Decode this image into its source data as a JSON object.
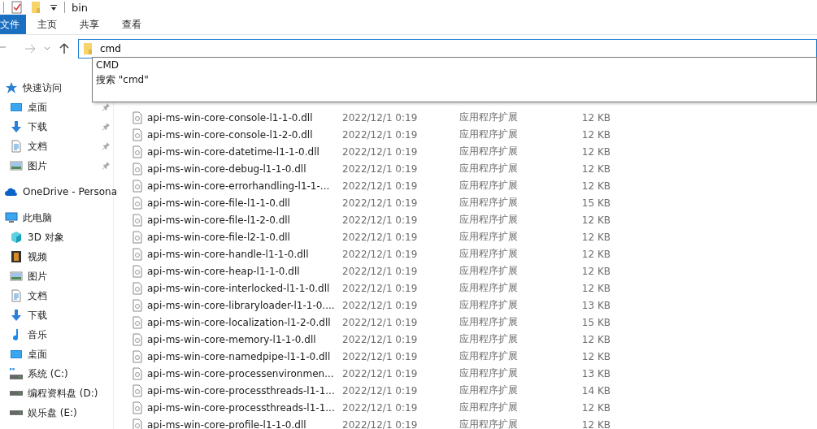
{
  "title_bar": {
    "title": "bin"
  },
  "ribbon": {
    "tabs": [
      {
        "label": "文件",
        "kind": "menu",
        "selected": false
      },
      {
        "label": "主页",
        "kind": "tab",
        "selected": false
      },
      {
        "label": "共享",
        "kind": "tab",
        "selected": false
      },
      {
        "label": "查看",
        "kind": "tab",
        "selected": false
      }
    ]
  },
  "address_bar": {
    "value": "cmd",
    "suggestions": [
      "CMD",
      "搜索 \"cmd\""
    ]
  },
  "sidebar": {
    "items": [
      {
        "label": "快速访问",
        "kind": "star",
        "children": [
          {
            "label": "桌面",
            "kind": "desktop",
            "pinned": true
          },
          {
            "label": "下载",
            "kind": "download",
            "pinned": true
          },
          {
            "label": "文档",
            "kind": "document",
            "pinned": true
          },
          {
            "label": "图片",
            "kind": "picture",
            "pinned": true
          }
        ]
      },
      {
        "label": "OneDrive - Persona",
        "kind": "cloud"
      },
      {
        "label": "此电脑",
        "kind": "pc",
        "children": [
          {
            "label": "3D 对象",
            "kind": "cube"
          },
          {
            "label": "视频",
            "kind": "video"
          },
          {
            "label": "图片",
            "kind": "picture"
          },
          {
            "label": "文档",
            "kind": "document"
          },
          {
            "label": "下载",
            "kind": "download"
          },
          {
            "label": "音乐",
            "kind": "music"
          },
          {
            "label": "桌面",
            "kind": "desktop"
          },
          {
            "label": "系统 (C:)",
            "kind": "system-drive"
          },
          {
            "label": "编程资料盘 (D:)",
            "kind": "drive"
          },
          {
            "label": "娱乐盘 (E:)",
            "kind": "drive"
          }
        ]
      }
    ]
  },
  "files": [
    {
      "name": "api-ms-win-core-console-l1-1-0.dll",
      "date": "2022/12/1 0:19",
      "type": "应用程序扩展",
      "size": "12 KB"
    },
    {
      "name": "api-ms-win-core-console-l1-2-0.dll",
      "date": "2022/12/1 0:19",
      "type": "应用程序扩展",
      "size": "12 KB"
    },
    {
      "name": "api-ms-win-core-datetime-l1-1-0.dll",
      "date": "2022/12/1 0:19",
      "type": "应用程序扩展",
      "size": "12 KB"
    },
    {
      "name": "api-ms-win-core-debug-l1-1-0.dll",
      "date": "2022/12/1 0:19",
      "type": "应用程序扩展",
      "size": "12 KB"
    },
    {
      "name": "api-ms-win-core-errorhandling-l1-1-...",
      "date": "2022/12/1 0:19",
      "type": "应用程序扩展",
      "size": "12 KB"
    },
    {
      "name": "api-ms-win-core-file-l1-1-0.dll",
      "date": "2022/12/1 0:19",
      "type": "应用程序扩展",
      "size": "15 KB"
    },
    {
      "name": "api-ms-win-core-file-l1-2-0.dll",
      "date": "2022/12/1 0:19",
      "type": "应用程序扩展",
      "size": "12 KB"
    },
    {
      "name": "api-ms-win-core-file-l2-1-0.dll",
      "date": "2022/12/1 0:19",
      "type": "应用程序扩展",
      "size": "12 KB"
    },
    {
      "name": "api-ms-win-core-handle-l1-1-0.dll",
      "date": "2022/12/1 0:19",
      "type": "应用程序扩展",
      "size": "12 KB"
    },
    {
      "name": "api-ms-win-core-heap-l1-1-0.dll",
      "date": "2022/12/1 0:19",
      "type": "应用程序扩展",
      "size": "12 KB"
    },
    {
      "name": "api-ms-win-core-interlocked-l1-1-0.dll",
      "date": "2022/12/1 0:19",
      "type": "应用程序扩展",
      "size": "12 KB"
    },
    {
      "name": "api-ms-win-core-libraryloader-l1-1-0....",
      "date": "2022/12/1 0:19",
      "type": "应用程序扩展",
      "size": "13 KB"
    },
    {
      "name": "api-ms-win-core-localization-l1-2-0.dll",
      "date": "2022/12/1 0:19",
      "type": "应用程序扩展",
      "size": "15 KB"
    },
    {
      "name": "api-ms-win-core-memory-l1-1-0.dll",
      "date": "2022/12/1 0:19",
      "type": "应用程序扩展",
      "size": "12 KB"
    },
    {
      "name": "api-ms-win-core-namedpipe-l1-1-0.dll",
      "date": "2022/12/1 0:19",
      "type": "应用程序扩展",
      "size": "12 KB"
    },
    {
      "name": "api-ms-win-core-processenvironmen...",
      "date": "2022/12/1 0:19",
      "type": "应用程序扩展",
      "size": "13 KB"
    },
    {
      "name": "api-ms-win-core-processthreads-l1-1...",
      "date": "2022/12/1 0:19",
      "type": "应用程序扩展",
      "size": "14 KB"
    },
    {
      "name": "api-ms-win-core-processthreads-l1-1...",
      "date": "2022/12/1 0:19",
      "type": "应用程序扩展",
      "size": "12 KB"
    },
    {
      "name": "api-ms-win-core-profile-l1-1-0.dll",
      "date": "2022/12/1 0:19",
      "type": "应用程序扩展",
      "size": "12 KB"
    }
  ]
}
